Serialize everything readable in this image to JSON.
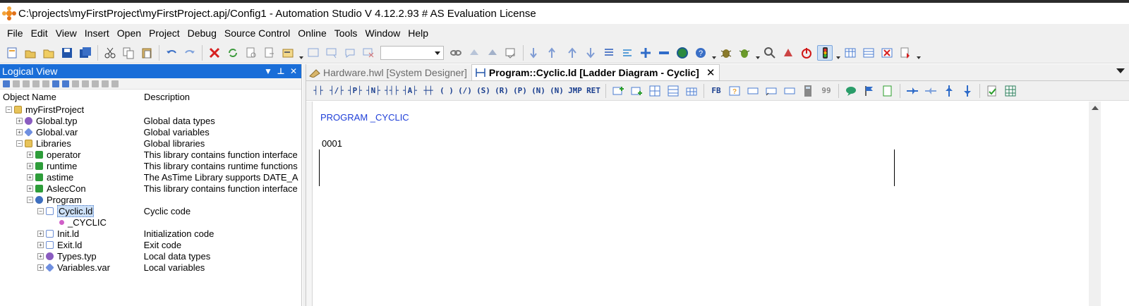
{
  "window": {
    "title": "C:\\projects\\myFirstProject\\myFirstProject.apj/Config1 - Automation Studio V 4.12.2.93 # AS Evaluation License"
  },
  "menu": [
    "File",
    "Edit",
    "View",
    "Insert",
    "Open",
    "Project",
    "Debug",
    "Source Control",
    "Online",
    "Tools",
    "Window",
    "Help"
  ],
  "toolbar": {
    "combo_value": ""
  },
  "logical_view": {
    "title": "Logical View",
    "col_name": "Object Name",
    "col_desc": "Description",
    "items": [
      {
        "name": "myFirstProject",
        "desc": ""
      },
      {
        "name": "Global.typ",
        "desc": "Global data types"
      },
      {
        "name": "Global.var",
        "desc": "Global variables"
      },
      {
        "name": "Libraries",
        "desc": "Global libraries"
      },
      {
        "name": "operator",
        "desc": "This library contains function interface"
      },
      {
        "name": "runtime",
        "desc": "This library contains runtime functions"
      },
      {
        "name": "astime",
        "desc": "The AsTime Library supports DATE_A"
      },
      {
        "name": "AslecCon",
        "desc": "This library contains function interface"
      },
      {
        "name": "Program",
        "desc": ""
      },
      {
        "name": "Cyclic.ld",
        "desc": "Cyclic code"
      },
      {
        "name": "_CYCLIC",
        "desc": ""
      },
      {
        "name": "Init.ld",
        "desc": "Initialization code"
      },
      {
        "name": "Exit.ld",
        "desc": "Exit code"
      },
      {
        "name": "Types.typ",
        "desc": "Local data types"
      },
      {
        "name": "Variables.var",
        "desc": "Local variables"
      }
    ]
  },
  "tabs": [
    {
      "label": "Hardware.hwl [System Designer]",
      "active": false
    },
    {
      "label": "Program::Cyclic.ld [Ladder Diagram - Cyclic]",
      "active": true
    }
  ],
  "ld_toolbar": [
    "JMP",
    "RET",
    "FB",
    "99"
  ],
  "editor": {
    "program_label": "PROGRAM _CYCLIC",
    "network_number": "0001"
  },
  "colors": {
    "panel_header": "#1a6ed8",
    "program_text": "#1f3fd8",
    "selection": "#cce0f7"
  }
}
